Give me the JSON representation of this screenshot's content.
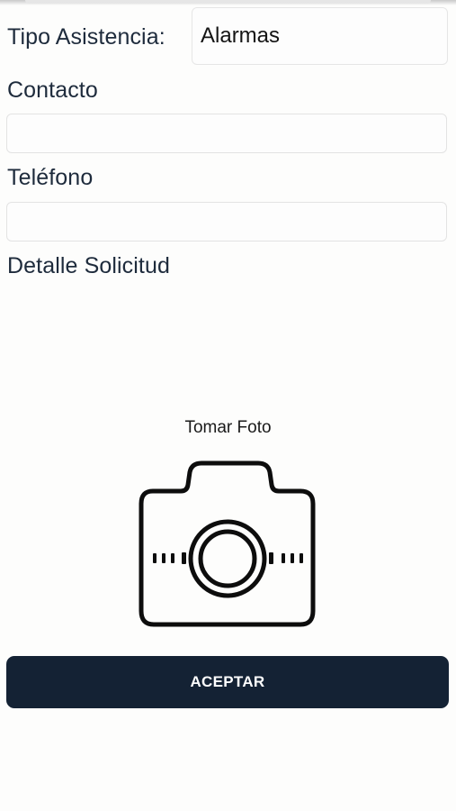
{
  "form": {
    "tipo_label": "Tipo Asistencia:",
    "tipo_value": "Alarmas",
    "contacto_label": "Contacto",
    "contacto_value": "",
    "telefono_label": "Teléfono",
    "telefono_value": "",
    "detalle_label": "Detalle Solicitud",
    "detalle_value": ""
  },
  "photo": {
    "label": "Tomar Foto",
    "icon": "camera-icon"
  },
  "actions": {
    "accept_label": "ACEPTAR"
  },
  "colors": {
    "button_bg": "#142234",
    "label_text": "#1e2b3c"
  }
}
